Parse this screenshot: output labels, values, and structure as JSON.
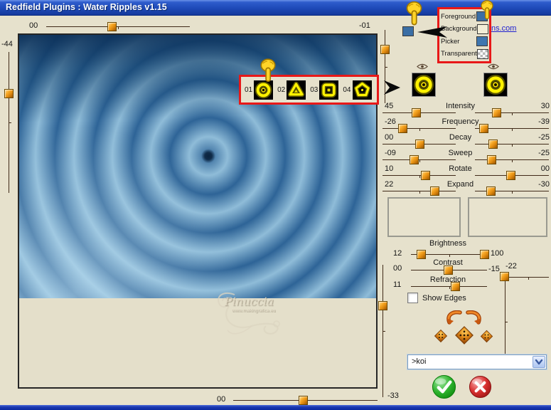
{
  "window": {
    "title": "Redfield Plugins : Water Ripples v1.15"
  },
  "preview": {
    "top_slider": {
      "left_value": "00",
      "right_value": "-01"
    },
    "left_slider": {
      "value": "-44"
    },
    "bottom_slider": {
      "left_value": "00",
      "right_value": "-33"
    },
    "watermark": {
      "name": "Pinuccia",
      "url": "www.makingrafica.eu"
    }
  },
  "annotations": {
    "link_text": "ns.com"
  },
  "pattern_picker": {
    "items": [
      {
        "num": "01",
        "shape": "rings"
      },
      {
        "num": "02",
        "shape": "triangle"
      },
      {
        "num": "03",
        "shape": "square"
      },
      {
        "num": "04",
        "shape": "pentagon"
      }
    ]
  },
  "color_panel": {
    "rows": [
      {
        "label": "Foreground",
        "color": "#3A6EA5"
      },
      {
        "label": "Background",
        "color": "#F2EDD7"
      },
      {
        "label": "Picker",
        "color": "#3F76AF"
      },
      {
        "label": "Transparent",
        "color": "checker"
      }
    ]
  },
  "sliders": [
    {
      "left": "45",
      "label": "Intensity",
      "right": "30"
    },
    {
      "left": "-26",
      "label": "Frequency",
      "right": "-39"
    },
    {
      "left": "00",
      "label": "Decay",
      "right": "-25"
    },
    {
      "left": "-09",
      "label": "Sweep",
      "right": "-25"
    },
    {
      "left": "10",
      "label": "Rotate",
      "right": "00"
    },
    {
      "left": "22",
      "label": "Expand",
      "right": "-30"
    }
  ],
  "adjustments": {
    "brightness": {
      "label": "Brightness",
      "left": "12",
      "right": "100"
    },
    "contrast": {
      "label": "Contrast",
      "left": "00",
      "right": "-15"
    },
    "vertical_value": "-22",
    "refraction": {
      "label": "Refraction",
      "left": "11"
    },
    "show_edges_label": "Show Edges"
  },
  "preset": {
    "value": ">koi"
  },
  "colors": {
    "handle_orange": "#F29A1E",
    "annotation_red": "#E81818",
    "titlebar_blue": "#1E4AB8",
    "link_blue": "#2020D0",
    "pattern_yellow": "#FFF200",
    "water_blue": "#2E6497"
  }
}
